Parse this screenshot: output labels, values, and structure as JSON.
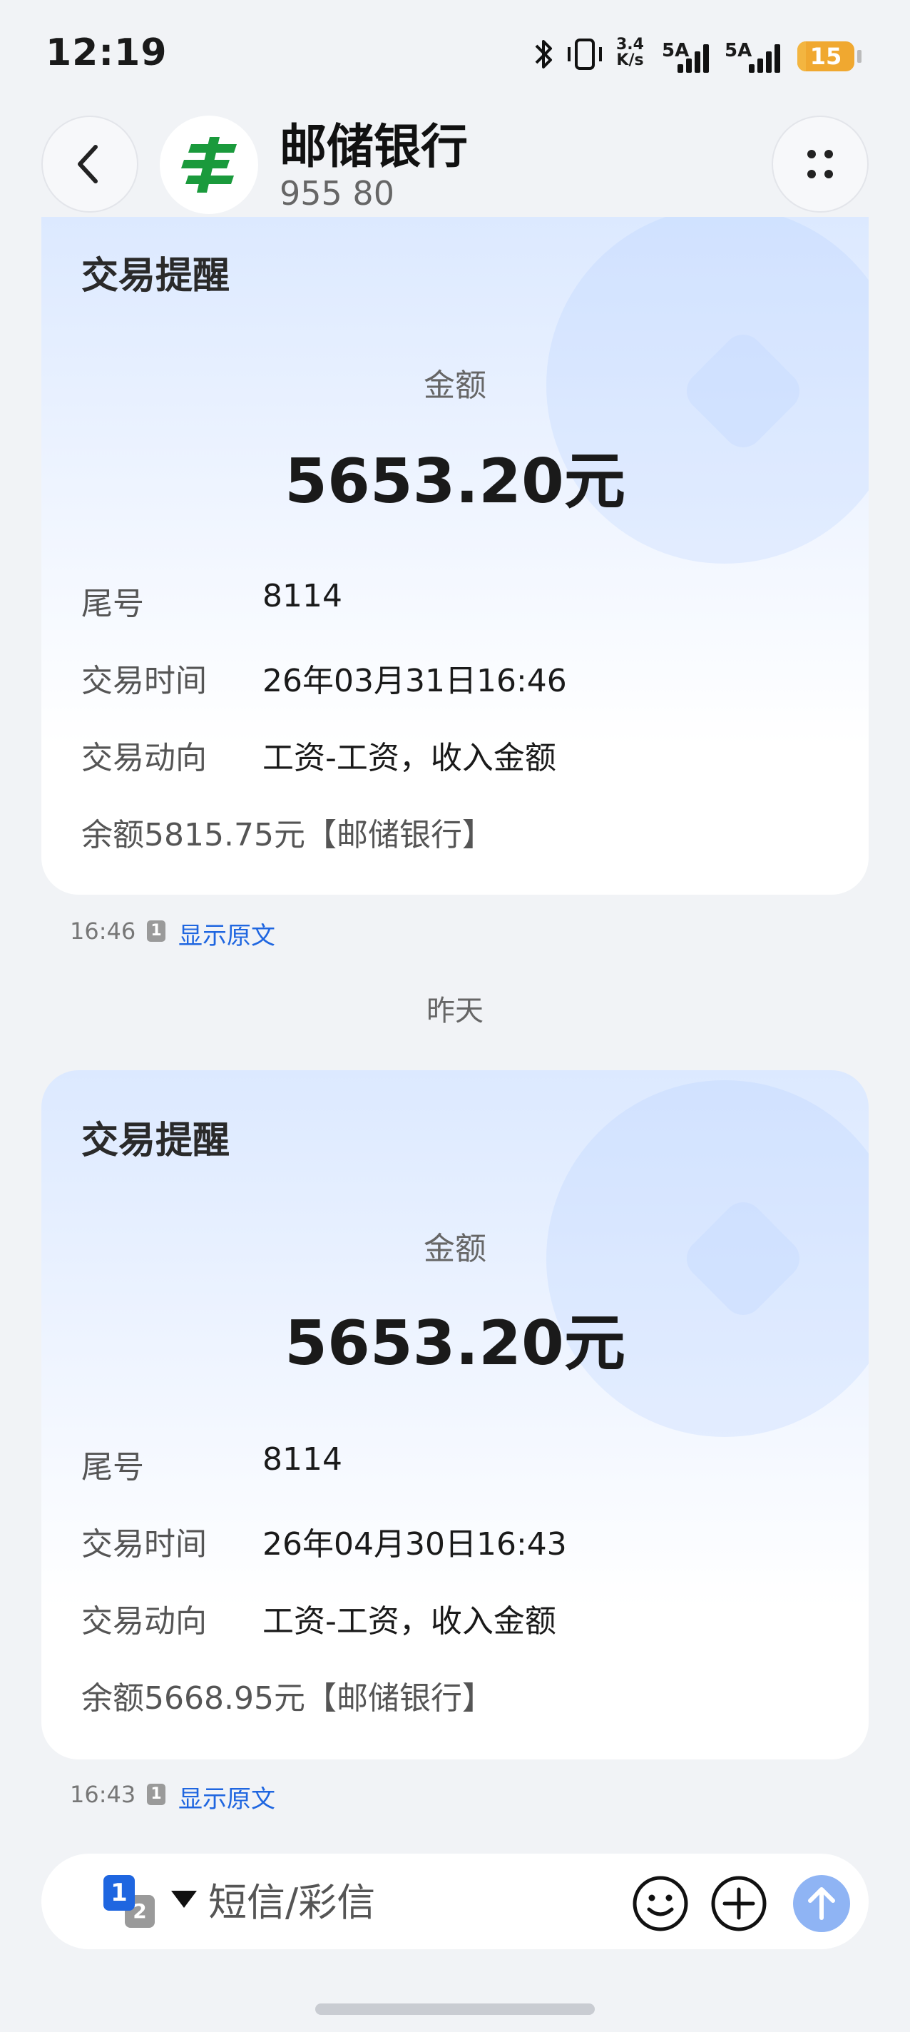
{
  "status_bar": {
    "time": "12:19",
    "net_speed_value": "3.4",
    "net_speed_unit": "K/s",
    "signal_1_label": "5A",
    "signal_2_label": "5A",
    "battery_level": "15",
    "battery_fraction": 0.15,
    "icons": [
      "bluetooth-icon",
      "vibrate-icon",
      "signal-icon",
      "signal-icon",
      "battery-icon"
    ]
  },
  "header": {
    "contact_name": "邮储银行",
    "contact_number": "955 80",
    "icons": [
      "chevron-left-icon",
      "bank-logo-icon",
      "more-dots-icon"
    ]
  },
  "messages": [
    {
      "title": "交易提醒",
      "amount_label": "金额",
      "amount_value": "5653.20元",
      "rows": [
        {
          "label": "尾号",
          "value": "8114"
        },
        {
          "label": "交易时间",
          "value": "26年03月31日16:46"
        },
        {
          "label": "交易动向",
          "value": "工资-工资，收入金额"
        }
      ],
      "balance": "余额5815.75元【邮储银行】",
      "time": "16:46",
      "sim": "1",
      "show_original": "显示原文"
    },
    {
      "title": "交易提醒",
      "amount_label": "金额",
      "amount_value": "5653.20元",
      "rows": [
        {
          "label": "尾号",
          "value": "8114"
        },
        {
          "label": "交易时间",
          "value": "26年04月30日16:43"
        },
        {
          "label": "交易动向",
          "value": "工资-工资，收入金额"
        }
      ],
      "balance": "余额5668.95元【邮储银行】",
      "time": "16:43",
      "sim": "1",
      "show_original": "显示原文"
    }
  ],
  "date_divider": "昨天",
  "input_bar": {
    "sim_primary": "1",
    "sim_secondary": "2",
    "placeholder": "短信/彩信",
    "icons": [
      "caret-down-icon",
      "emoji-icon",
      "add-icon",
      "send-arrow-icon"
    ]
  },
  "colors": {
    "accent": "#1f66e0",
    "send_button": "#8fb4f4",
    "battery": "#f0a830",
    "bank_green": "#1a9a3c"
  }
}
